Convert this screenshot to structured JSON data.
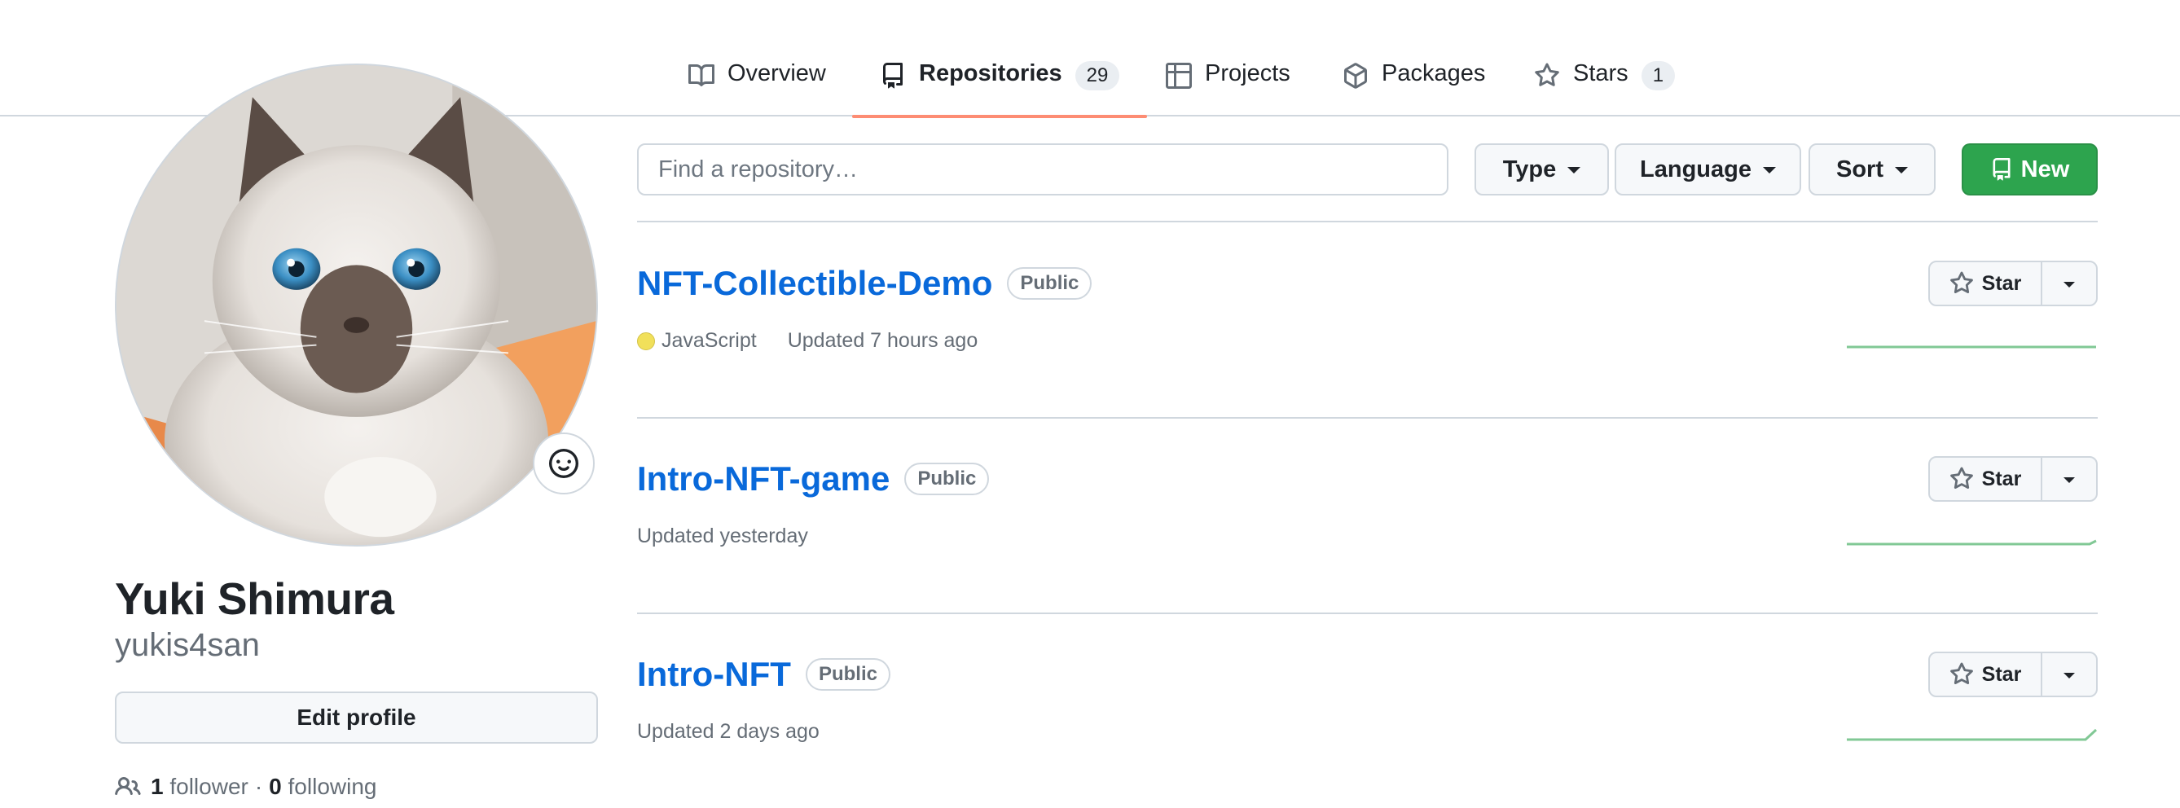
{
  "tabs": [
    {
      "label": "Overview",
      "icon": "book-icon",
      "selected": false
    },
    {
      "label": "Repositories",
      "icon": "repo-icon",
      "count": "29",
      "selected": true
    },
    {
      "label": "Projects",
      "icon": "table-icon",
      "selected": false
    },
    {
      "label": "Packages",
      "icon": "package-icon",
      "selected": false
    },
    {
      "label": "Stars",
      "icon": "star-icon",
      "count": "1",
      "selected": false
    }
  ],
  "profile": {
    "avatar": "cat-photo",
    "status_icon": "smiley-icon",
    "fullname": "Yuki Shimura",
    "username": "yukis4san",
    "edit_label": "Edit profile",
    "followers_count": "1",
    "followers_label": "follower",
    "separator": "·",
    "following_count": "0",
    "following_label": "following"
  },
  "filters": {
    "search_placeholder": "Find a repository…",
    "type_label": "Type",
    "language_label": "Language",
    "sort_label": "Sort",
    "new_label": "New"
  },
  "repos": [
    {
      "name": "NFT-Collectible-Demo",
      "visibility": "Public",
      "language": "JavaScript",
      "language_color": "#f1e05a",
      "updated": "Updated 7 hours ago",
      "star_label": "Star"
    },
    {
      "name": "Intro-NFT-game",
      "visibility": "Public",
      "updated": "Updated yesterday",
      "star_label": "Star"
    },
    {
      "name": "Intro-NFT",
      "visibility": "Public",
      "updated": "Updated 2 days ago",
      "star_label": "Star"
    }
  ],
  "colors": {
    "link": "#0969da",
    "primary_button": "#2da44e",
    "tab_underline": "#fd8c73",
    "sparkline": "#2da44e"
  }
}
